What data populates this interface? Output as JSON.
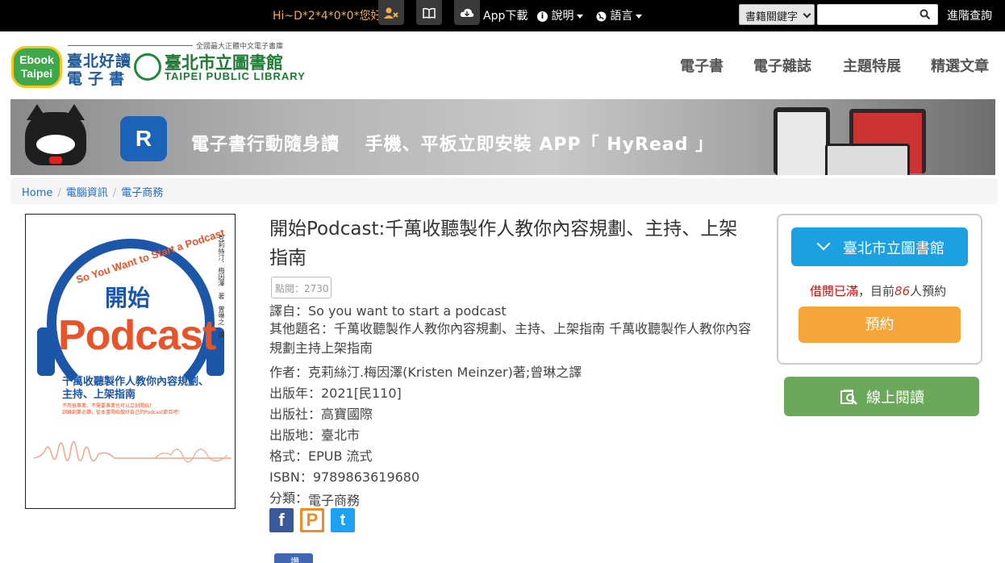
{
  "topbar": {
    "greeting": "Hi~D*2*4*0*0*您好!",
    "app_download": "App下載",
    "help": "說明",
    "language": "語言",
    "search_select": "書籍關鍵字",
    "search_placeholder": "",
    "advanced_search": "進階查詢"
  },
  "header": {
    "ebook_logo_line1": "Ebook",
    "ebook_logo_line2": "Taipei",
    "site_name_line1": "臺北好讀",
    "site_name_line2": "電子書",
    "library_tagline": "全國最大正體中文電子書庫",
    "library_name": "臺北市立圖書館",
    "library_name_en": "TAIPEI PUBLIC LIBRARY",
    "nav": [
      "電子書",
      "電子雜誌",
      "主題特展",
      "精選文章"
    ]
  },
  "banner": {
    "app_letter": "R",
    "text": "電子書行動隨身讀　 手機、平板立即安裝 APP「 HyRead 」"
  },
  "breadcrumb": [
    "Home",
    "電腦資訊",
    "電子商務"
  ],
  "cover": {
    "en_title": "So You Want to Start a Podcast",
    "zh_title": "開始",
    "main_title": "Podcast",
    "subtitle_line1": "千萬收聽製作人教你內容規劃、",
    "subtitle_line2": "主持、上架指南",
    "note_line1": "不用很專業、不需要專業也可以立刻開始！",
    "note_line2": "訓練創業必讀，從本書開始做好自己的Podcast節目吧！",
    "side_text": "克莉絲汀．梅因澤　著　曾琳之　譯"
  },
  "book": {
    "title": "開始Podcast:千萬收聽製作人教你內容規劃、主持、上架指南",
    "hits": "點閱：2730",
    "translated_from": "譯自：So you want to start a podcast",
    "other_titles": "其他題名：千萬收聽製作人教你內容規劃、主持、上架指南 千萬收聽製作人教你內容規劃主持上架指南",
    "author": "作者：克莉絲汀.梅因澤(Kristen Meinzer)著;曾琳之譯",
    "year": "出版年：2021[民110]",
    "publisher": "出版社：高寶國際",
    "place": "出版地：臺北市",
    "format": "格式：EPUB 流式",
    "isbn": "ISBN：9789863619680",
    "category_label": "分類：",
    "category_value": "電子商務"
  },
  "share": {
    "facebook": "f",
    "plurk": "P",
    "twitter": "t",
    "fb_like": "讚"
  },
  "panel": {
    "library_button": "臺北市立圖書館",
    "status_full": "借閱已滿",
    "status_mid": "，目前",
    "status_count": "86",
    "status_suffix": "人預約",
    "reserve_button": "預約",
    "read_online_button": "線上閱讀"
  },
  "colors": {
    "topbar_bg": "#000000",
    "greeting": "#f0ad4e",
    "library_button": "#1ba0e2",
    "reserve_button": "#f5a53a",
    "read_button": "#6aa95a",
    "status_full": "#d40000",
    "link": "#2a6db5"
  },
  "icons": [
    "user-times-icon",
    "book-icon",
    "cloud-download-icon",
    "info-icon",
    "globe-icon",
    "search-icon",
    "chevron-down-icon",
    "read-online-icon"
  ]
}
